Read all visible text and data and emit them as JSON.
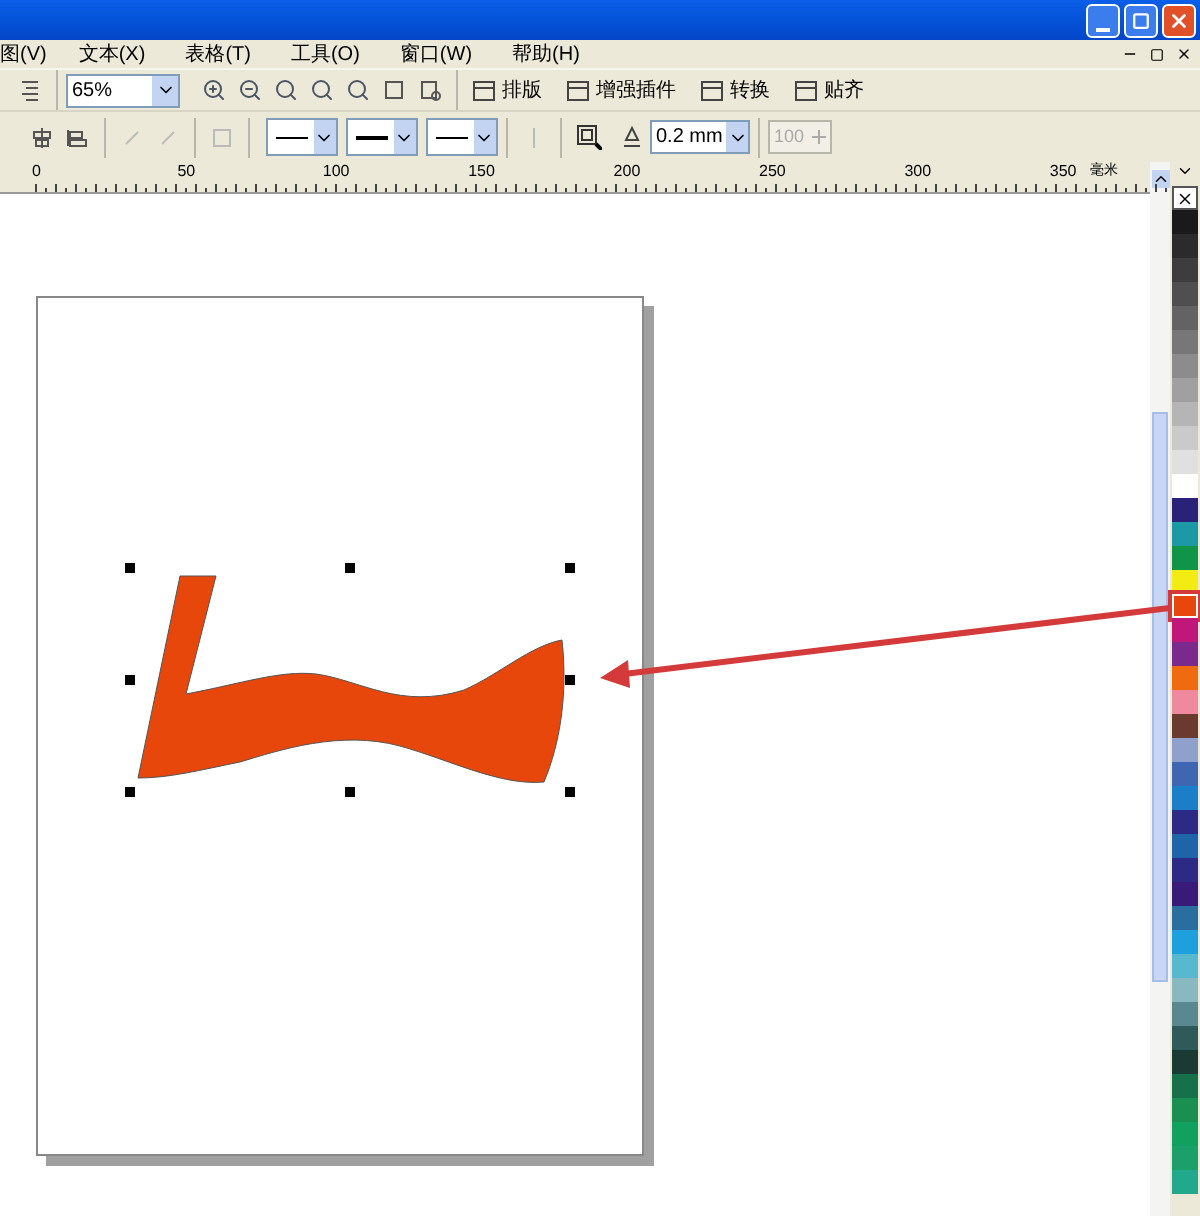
{
  "menu": [
    {
      "label": "图(V)"
    },
    {
      "label": "文本(X)"
    },
    {
      "label": "表格(T)"
    },
    {
      "label": "工具(O)"
    },
    {
      "label": "窗口(W)"
    },
    {
      "label": "帮助(H)"
    }
  ],
  "toolbar": {
    "zoom": "65%",
    "plugins": [
      {
        "label": "排版"
      },
      {
        "label": "增强插件"
      },
      {
        "label": "转换"
      },
      {
        "label": "贴齐"
      }
    ]
  },
  "property_bar": {
    "outline_width": "0.2 mm",
    "disabled_value": "100"
  },
  "ruler": {
    "labels": [
      "0",
      "50",
      "100",
      "150",
      "200",
      "250",
      "300",
      "350"
    ],
    "unit": "毫米"
  },
  "palette": [
    {
      "color": "#1a1a1a",
      "selected": false
    },
    {
      "color": "#2b2b2b",
      "selected": false
    },
    {
      "color": "#3d3d3d",
      "selected": false
    },
    {
      "color": "#4f4f4f",
      "selected": false
    },
    {
      "color": "#636363",
      "selected": false
    },
    {
      "color": "#777777",
      "selected": false
    },
    {
      "color": "#8c8c8c",
      "selected": false
    },
    {
      "color": "#a0a0a0",
      "selected": false
    },
    {
      "color": "#b5b5b5",
      "selected": false
    },
    {
      "color": "#cacaca",
      "selected": false
    },
    {
      "color": "#e0e0e0",
      "selected": false
    },
    {
      "color": "#ffffff",
      "selected": false
    },
    {
      "color": "#2a2278",
      "selected": false
    },
    {
      "color": "#1b9aa6",
      "selected": false
    },
    {
      "color": "#109548",
      "selected": false
    },
    {
      "color": "#f2ec12",
      "selected": false
    },
    {
      "color": "#e8470c",
      "selected": true
    },
    {
      "color": "#c0187a",
      "selected": false
    },
    {
      "color": "#7a2a8c",
      "selected": false
    },
    {
      "color": "#f06a10",
      "selected": false
    },
    {
      "color": "#ef8a9e",
      "selected": false
    },
    {
      "color": "#6b3a2e",
      "selected": false
    },
    {
      "color": "#8fa0cc",
      "selected": false
    },
    {
      "color": "#3f66b0",
      "selected": false
    },
    {
      "color": "#1a7fc8",
      "selected": false
    },
    {
      "color": "#2c2a84",
      "selected": false
    },
    {
      "color": "#1d64a8",
      "selected": false
    },
    {
      "color": "#2d2a86",
      "selected": false
    },
    {
      "color": "#3a1a78",
      "selected": false
    },
    {
      "color": "#2a6ea0",
      "selected": false
    },
    {
      "color": "#1ea0dc",
      "selected": false
    },
    {
      "color": "#58b8d0",
      "selected": false
    },
    {
      "color": "#8ab8c0",
      "selected": false
    },
    {
      "color": "#5a8890",
      "selected": false
    },
    {
      "color": "#2e5a5a",
      "selected": false
    },
    {
      "color": "#1a3a34",
      "selected": false
    },
    {
      "color": "#16704a",
      "selected": false
    },
    {
      "color": "#1a9050",
      "selected": false
    },
    {
      "color": "#10a060",
      "selected": false
    },
    {
      "color": "#1aa068",
      "selected": false
    },
    {
      "color": "#22a88a",
      "selected": false
    }
  ]
}
